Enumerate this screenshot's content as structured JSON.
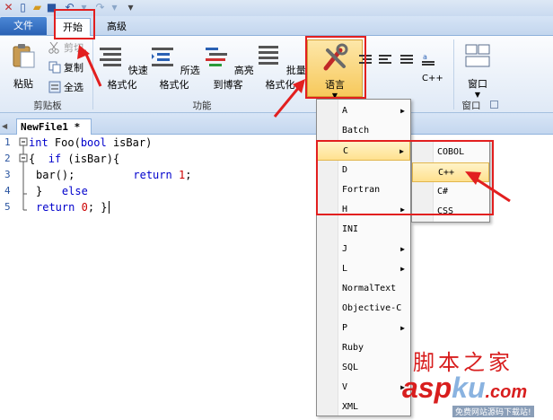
{
  "ribbon_tabs": {
    "file": "文件",
    "home": "开始",
    "advanced": "高级"
  },
  "clipboard": {
    "paste": "粘贴",
    "cut": "剪切",
    "copy": "复制",
    "select_all": "全选",
    "group": "剪贴板"
  },
  "functions": {
    "quick_format": "快速格式化",
    "selected_format": "所选格式化",
    "hot_copy": "高亮到博客",
    "batch_format": "批量格式化",
    "language": "语言",
    "cpp_label": "C++",
    "group": "功能"
  },
  "window": {
    "label": "窗口",
    "group": "窗口"
  },
  "document": {
    "tab": "NewFile1 *"
  },
  "code": {
    "line_numbers": [
      "1",
      "2",
      "3",
      "4",
      "5"
    ],
    "lines": [
      {
        "kw1": "int",
        "t1": " Foo(",
        "kw2": "bool",
        "t2": " isBar)"
      },
      {
        "t1": "{  ",
        "kw1": "if",
        "t2": " (isBar){"
      },
      {
        "t1": "bar();         ",
        "kw1": "return",
        "t2": " ",
        "n": "1",
        "t3": ";"
      },
      {
        "t1": "}   ",
        "kw1": "else"
      },
      {
        "kw1": "return",
        "t1": " ",
        "n": "0",
        "t2": "; }"
      }
    ]
  },
  "language_menu": {
    "items": [
      "A",
      "Batch",
      "C",
      "D",
      "Fortran",
      "H",
      "INI",
      "J",
      "L",
      "NormalText",
      "Objective-C",
      "P",
      "Ruby",
      "SQL",
      "V",
      "XML"
    ],
    "submenu_flags": [
      true,
      false,
      true,
      false,
      false,
      true,
      false,
      true,
      true,
      false,
      false,
      true,
      false,
      false,
      true,
      false
    ],
    "highlighted": "C"
  },
  "c_submenu": {
    "items": [
      "COBOL",
      "C++",
      "C#",
      "CSS"
    ],
    "highlighted": "C++"
  },
  "watermark": {
    "cn": "脚本之家",
    "brand_a": "asp",
    "brand_b": "ku",
    "brand_c": ".com",
    "tagline": "免费网站源码下载站!"
  },
  "colors": {
    "annotation_red": "#e21f1f",
    "keyword": "#0000cc",
    "number": "#cc0000",
    "accent": "#2a61b4"
  }
}
